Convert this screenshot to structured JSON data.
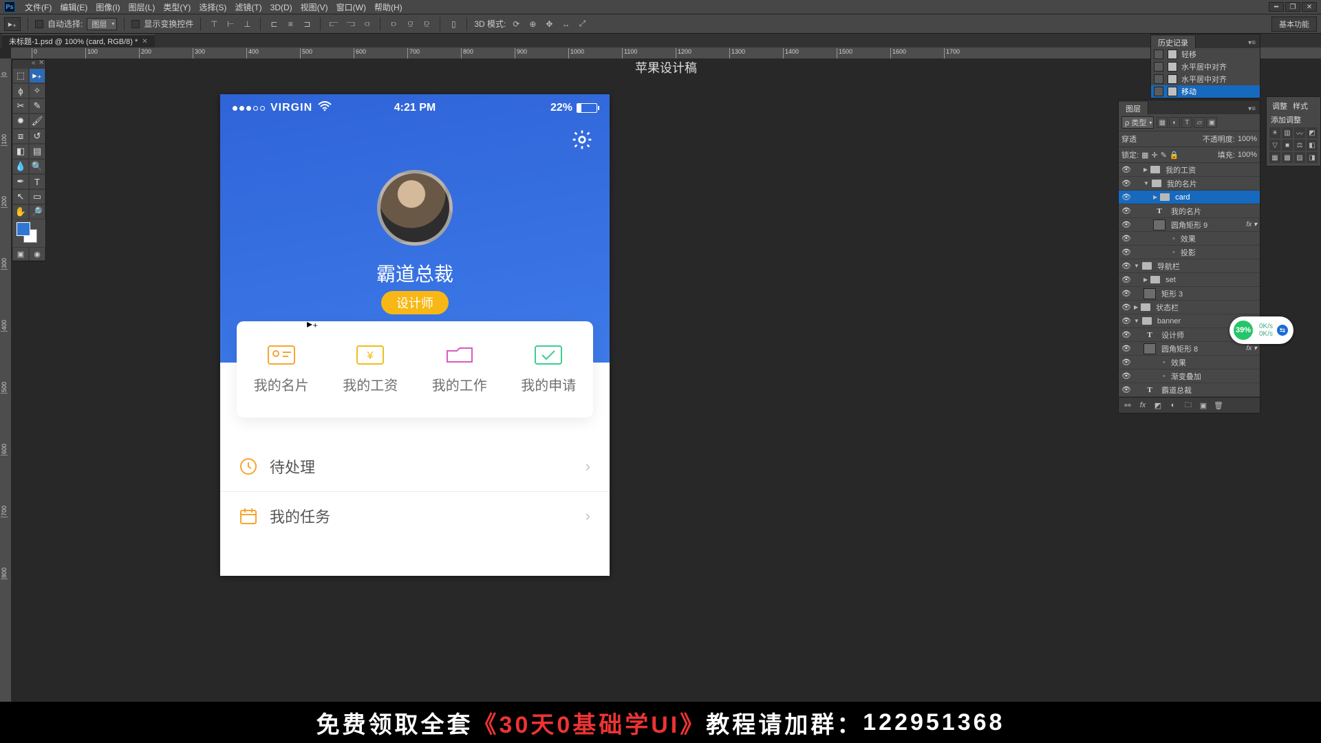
{
  "menu": [
    "文件(F)",
    "编辑(E)",
    "图像(I)",
    "图层(L)",
    "类型(Y)",
    "选择(S)",
    "滤镜(T)",
    "3D(D)",
    "视图(V)",
    "窗口(W)",
    "帮助(H)"
  ],
  "opt": {
    "autoSelectLabel": "自动选择:",
    "autoSelectTarget": "图层",
    "showTransform": "显示变换控件",
    "mode3d": "3D 模式:",
    "rightPill": "基本功能"
  },
  "doc": {
    "title": "未标题-1.psd @ 100% (card, RGB/8) *"
  },
  "rulerH": [
    0,
    100,
    200,
    300,
    400,
    500,
    600,
    700,
    800,
    900,
    1000,
    1100,
    1200,
    1300,
    1400,
    1500,
    1600,
    1700
  ],
  "rulerV": [
    0,
    100,
    200,
    300,
    400,
    500,
    600,
    700,
    800
  ],
  "design": {
    "title": "苹果设计稿",
    "statusbar": {
      "carrier": "VIRGIN",
      "time": "4:21 PM",
      "battery": "22%"
    },
    "username": "霸道总裁",
    "role": "设计师",
    "cards": [
      "我的名片",
      "我的工资",
      "我的工作",
      "我的申请"
    ],
    "list": [
      "待处理",
      "我的任务"
    ]
  },
  "historyPanel": {
    "tab": "历史记录",
    "items": [
      "轻移",
      "水平居中对齐",
      "水平居中对齐",
      "移动"
    ],
    "selectedIndex": 3
  },
  "adjust": {
    "tab1": "调整",
    "tab2": "样式",
    "title": "添加调整"
  },
  "layers": {
    "tab": "图层",
    "kind": "ρ 类型",
    "blend": "穿透",
    "opacityLabel": "不透明度:",
    "opacity": "100%",
    "lockLabel": "锁定:",
    "fillLabel": "填充:",
    "fill": "100%",
    "rows": [
      {
        "type": "folder",
        "label": "我的工资",
        "indent": 1,
        "tw": "▶"
      },
      {
        "type": "folder",
        "label": "我的名片",
        "indent": 1,
        "tw": "▼"
      },
      {
        "type": "folder",
        "label": "card",
        "indent": 2,
        "tw": "▶",
        "sel": true
      },
      {
        "type": "T",
        "label": "我的名片",
        "indent": 2
      },
      {
        "type": "thumb",
        "label": "圆角矩形 9",
        "indent": 2,
        "fx": true
      },
      {
        "type": "fx",
        "label": "效果",
        "indent": 3
      },
      {
        "type": "fx",
        "label": "投影",
        "indent": 3
      },
      {
        "type": "folder",
        "label": "导航栏",
        "indent": 0,
        "tw": "▼"
      },
      {
        "type": "folder",
        "label": "set",
        "indent": 1,
        "tw": "▶"
      },
      {
        "type": "thumb",
        "label": "矩形 3",
        "indent": 1
      },
      {
        "type": "folder",
        "label": "状态栏",
        "indent": 0,
        "tw": "▶"
      },
      {
        "type": "folder",
        "label": "banner",
        "indent": 0,
        "tw": "▼"
      },
      {
        "type": "T",
        "label": "设计师",
        "indent": 1
      },
      {
        "type": "thumb",
        "label": "圆角矩形 8",
        "indent": 1,
        "fx": true
      },
      {
        "type": "fx",
        "label": "效果",
        "indent": 2
      },
      {
        "type": "fx",
        "label": "渐变叠加",
        "indent": 2
      },
      {
        "type": "T",
        "label": "霸道总裁",
        "indent": 1
      }
    ]
  },
  "net": {
    "pct": "39%",
    "up": "0K/s",
    "down": "0K/s"
  },
  "promo": {
    "a": "免费领取全套",
    "b": "《30天0基础学UI》",
    "c": "教程请加群：",
    "d": "122951368"
  }
}
